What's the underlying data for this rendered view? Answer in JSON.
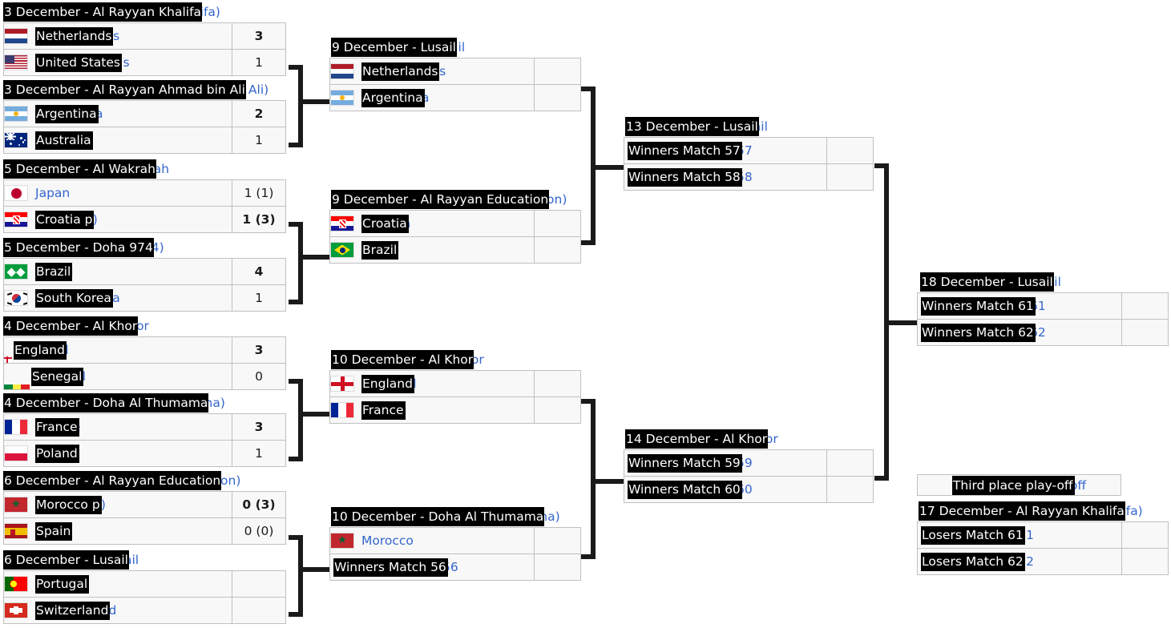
{
  "meta": {
    "title": "FIFA World Cup knockout bracket",
    "accent_link_color": "#3366cc",
    "selection_bg": "#000000",
    "selection_fg": "#ffffff",
    "cell_bg": "#f8f8f8",
    "cell_border": "#c0c0c0",
    "connector_color": "#1a1a1a"
  },
  "round16": [
    {
      "header_selected": "3 December - Al Rayyan Khalifa",
      "header_tail": "halifa)",
      "teams": [
        {
          "name": "Netherlands",
          "tail": "s",
          "flag": "netherlands-flag",
          "score": "3",
          "winner": true
        },
        {
          "name": "United States",
          "tail": "s",
          "flag": "united-states-flag",
          "score": "1",
          "winner": false
        }
      ]
    },
    {
      "header_selected": "3 December - Al Rayyan Ahmad bin Ali",
      "header_tail": "bin Ali)",
      "teams": [
        {
          "name": "Argentina",
          "tail": "a",
          "flag": "argentina-flag",
          "score": "2",
          "winner": true
        },
        {
          "name": "Australia",
          "tail": "",
          "flag": "australia-flag",
          "score": "1",
          "winner": false
        }
      ]
    },
    {
      "header_selected": "5 December - Al Wakrah",
      "header_tail": "rah",
      "teams": [
        {
          "name": "Japan",
          "tail": "",
          "flag": "japan-flag",
          "score": "1 (1)",
          "winner": false,
          "unselected": true
        },
        {
          "name": "Croatia p",
          "tail": "(p)",
          "flag": "croatia-flag",
          "score": "1 (3)",
          "winner": true
        }
      ]
    },
    {
      "header_selected": "5 December - Doha 974",
      "header_tail": "974)",
      "teams": [
        {
          "name": "Brazil",
          "tail": "l",
          "flag": "brazil-flag-glyph",
          "score": "4",
          "winner": true
        },
        {
          "name": "South Korea",
          "tail": "a",
          "flag": "south-korea-flag",
          "score": "1",
          "winner": false
        }
      ]
    },
    {
      "header_selected": "4 December - Al Khor",
      "header_tail": "hor",
      "teams": [
        {
          "name": "England",
          "tail": "ngland",
          "flag": "england-flag-narrow",
          "score": "3",
          "winner": true
        },
        {
          "name": "Senegal",
          "tail": "negal",
          "flag": "senegal-flag-narrow",
          "score": "0",
          "winner": false
        }
      ]
    },
    {
      "header_selected": "4 December - Doha Al Thumama",
      "header_tail": "hama)",
      "teams": [
        {
          "name": "France",
          "tail": "e",
          "flag": "france-flag",
          "score": "3",
          "winner": true
        },
        {
          "name": "Poland",
          "tail": "",
          "flag": "poland-flag",
          "score": "1",
          "winner": false
        }
      ]
    },
    {
      "header_selected": "6 December - Al Rayyan Education",
      "header_tail": "cation)",
      "teams": [
        {
          "name": "Morocco p",
          "tail": "(p)",
          "flag": "morocco-flag",
          "score": "0 (3)",
          "winner": true
        },
        {
          "name": "Spain",
          "tail": "",
          "flag": "spain-flag",
          "score": "0 (0)",
          "winner": false
        }
      ]
    },
    {
      "header_selected": "6 December - Lusail",
      "header_tail": "ail",
      "teams": [
        {
          "name": "Portugal",
          "tail": "",
          "flag": "portugal-flag",
          "score": "",
          "winner": false
        },
        {
          "name": "Switzerland",
          "tail": "d",
          "flag": "switzerland-flag",
          "score": "",
          "winner": false
        }
      ]
    }
  ],
  "quarterfinals": [
    {
      "header_selected": "9 December - Lusail",
      "header_tail": "sail",
      "teams": [
        {
          "name": "Netherlands",
          "tail": "s",
          "flag": "netherlands-flag",
          "score": ""
        },
        {
          "name": "Argentina",
          "tail": "a",
          "flag": "argentina-flag",
          "score": ""
        }
      ]
    },
    {
      "header_selected": "9 December - Al Rayyan Education",
      "header_tail": "cation)",
      "teams": [
        {
          "name": "Croatia",
          "tail": "a",
          "flag": "croatia-flag",
          "score": ""
        },
        {
          "name": "Brazil",
          "tail": "",
          "flag": "brazil-flag",
          "score": ""
        }
      ]
    },
    {
      "header_selected": "10 December - Al Khor",
      "header_tail": "hor",
      "teams": [
        {
          "name": "England",
          "tail": "d",
          "flag": "england-flag",
          "score": ""
        },
        {
          "name": "France",
          "tail": "",
          "flag": "france-flag",
          "score": ""
        }
      ]
    },
    {
      "header_selected": "10 December - Doha Al Thumama",
      "header_tail": "hama)",
      "teams": [
        {
          "name": "Morocco",
          "tail": "",
          "flag": "morocco-flag",
          "score": "",
          "unselected": true
        },
        {
          "name": "Winners Match 56",
          "tail": "56",
          "flag": "none",
          "score": ""
        }
      ]
    }
  ],
  "semifinals": [
    {
      "header_selected": "13 December - Lusail",
      "header_tail": "sail",
      "teams": [
        {
          "name": "Winners Match 57",
          "tail": "57",
          "score": ""
        },
        {
          "name": "Winners Match 58",
          "tail": "58",
          "score": ""
        }
      ]
    },
    {
      "header_selected": "14 December - Al Khor",
      "header_tail": "hor",
      "teams": [
        {
          "name": "Winners Match 59",
          "tail": "59",
          "score": ""
        },
        {
          "name": "Winners Match 60",
          "tail": "60",
          "score": ""
        }
      ]
    }
  ],
  "final": {
    "header_selected": "18 December - Lusail",
    "header_tail": "sail",
    "teams": [
      {
        "name": "Winners Match 61",
        "tail": "61",
        "score": ""
      },
      {
        "name": "Winners Match 62",
        "tail": "62",
        "score": ""
      }
    ]
  },
  "third_place": {
    "title_selected": "Third place play-off",
    "title_tail": "off",
    "header_selected": "17 December - Al Rayyan Khalifa",
    "header_tail": "halifa)",
    "teams": [
      {
        "name": "Losers Match 61",
        "tail": "1",
        "score": ""
      },
      {
        "name": "Losers Match 62",
        "tail": "2",
        "score": ""
      }
    ]
  }
}
